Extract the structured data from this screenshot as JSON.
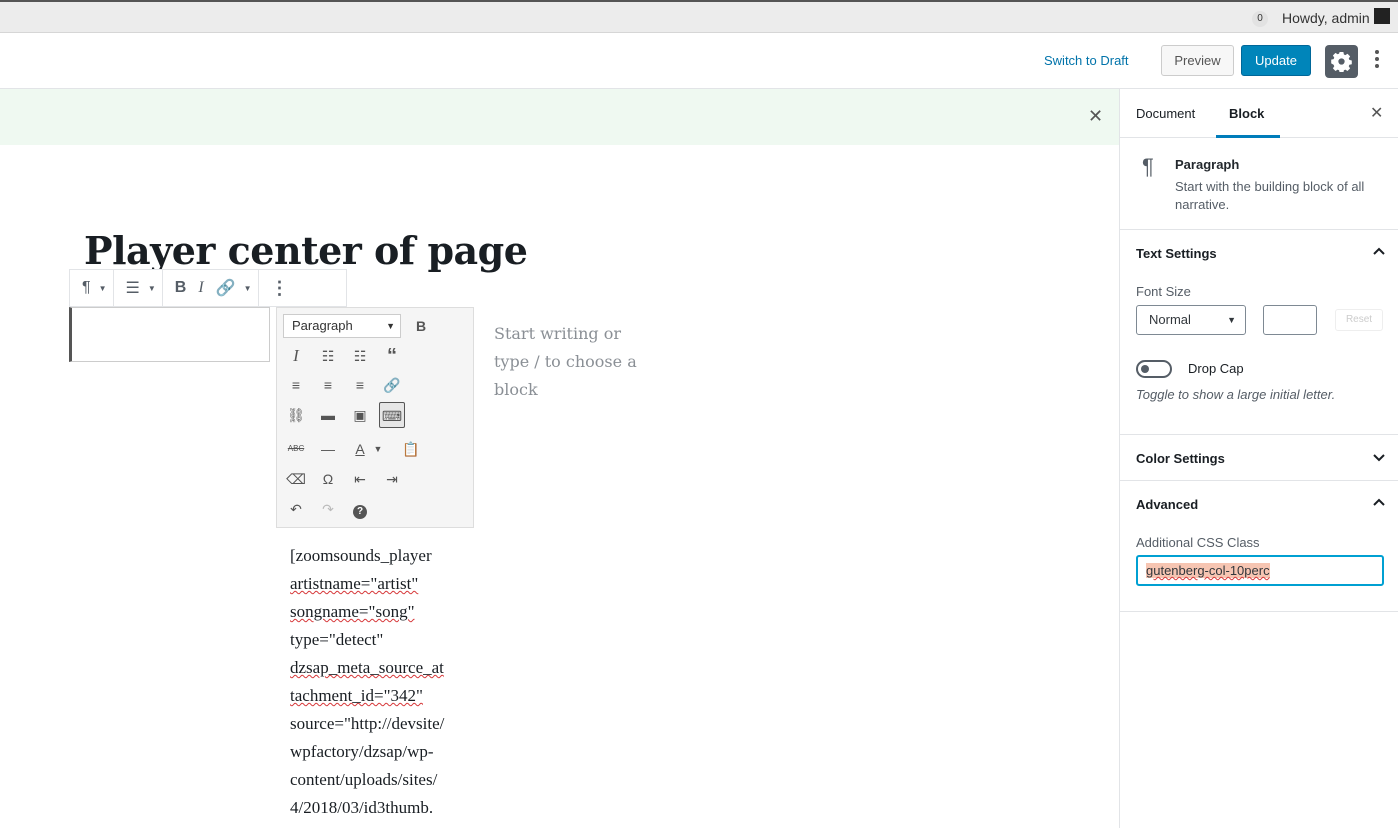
{
  "adminbar": {
    "count": "0",
    "howdy": "Howdy, admin"
  },
  "header": {
    "switch_draft": "Switch to Draft",
    "preview": "Preview",
    "update": "Update"
  },
  "editor": {
    "title": "Player center of page",
    "placeholder": "Start writing or type / to choose a block",
    "format_select": "Paragraph",
    "shortcode_lines": [
      "[zoomsounds_player",
      "artistname=\"artist\"",
      "songname=\"song\"",
      "type=\"detect\"",
      "dzsap_meta_source_at",
      "tachment_id=\"342\"",
      "source=\"http://devsite/",
      "wpfactory/dzsap/wp-",
      "content/uploads/sites/",
      "4/2018/03/id3thumb."
    ]
  },
  "sidebar": {
    "tabs": [
      "Document",
      "Block"
    ],
    "block_name": "Paragraph",
    "block_desc": "Start with the building block of all narrative.",
    "text_settings": "Text Settings",
    "font_size_label": "Font Size",
    "font_size_value": "Normal",
    "reset": "Reset",
    "drop_cap": "Drop Cap",
    "drop_cap_help": "Toggle to show a large initial letter.",
    "color_settings": "Color Settings",
    "advanced": "Advanced",
    "css_label": "Additional CSS Class",
    "css_value": "gutenberg-col-10perc"
  }
}
